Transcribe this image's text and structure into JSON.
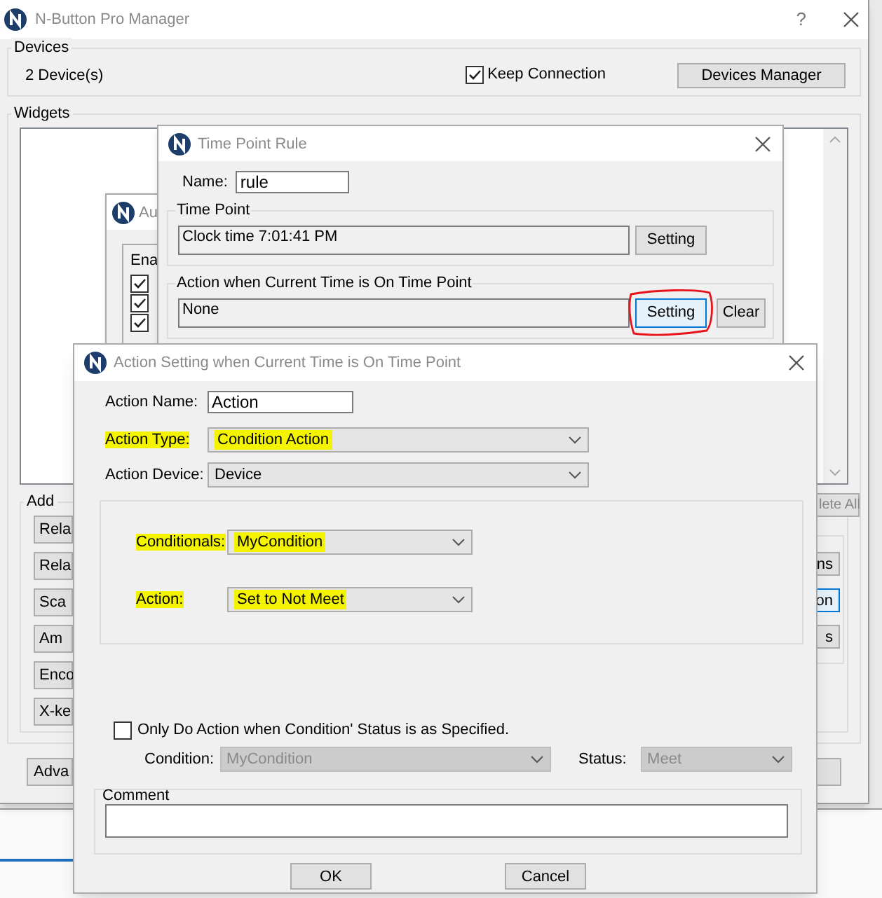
{
  "main_window": {
    "title": "N-Button Pro Manager",
    "help": "?",
    "devices": {
      "label": "Devices",
      "count": "2 Device(s)",
      "keep_connection": {
        "label": "Keep Connection",
        "checked": true
      },
      "manager_button": "Devices Manager"
    },
    "widgets": {
      "label": "Widgets",
      "add": {
        "label": "Add",
        "left_buttons": [
          "Rela",
          "Rela",
          "Sca",
          "Am",
          "Enco",
          "X-ke"
        ],
        "delete_all_button": "lete All",
        "right_buttons": [
          {
            "label": "ns",
            "focused": false
          },
          {
            "label": "on",
            "focused": true
          },
          {
            "label": "s",
            "focused": false
          }
        ]
      }
    },
    "bottom_button": "Adva"
  },
  "auto_window": {
    "title": "Au",
    "column_header": "Ena",
    "rows": [
      {
        "checked": true
      },
      {
        "checked": true
      },
      {
        "checked": true
      }
    ]
  },
  "time_point_window": {
    "title": "Time Point Rule",
    "name_label": "Name:",
    "name_value": "rule",
    "time_point": {
      "label": "Time Point",
      "value": "Clock time 7:01:41 PM",
      "button": {
        "label": "Setting",
        "focused": false
      }
    },
    "action": {
      "label": "Action when Current Time is On Time Point",
      "value": "None",
      "button": {
        "label": "Setting",
        "focused": true,
        "circled": true
      },
      "clear_button": "Clear"
    }
  },
  "action_dialog": {
    "title": "Action Setting when Current Time is On Time Point",
    "action_name": {
      "label": "Action Name:",
      "value": "Action"
    },
    "fields": [
      {
        "label": "Action Type:",
        "value": "Condition Action",
        "highlighted": true
      },
      {
        "label": "Action Device:",
        "value": "Device",
        "highlighted": false
      }
    ],
    "condition_fields": [
      {
        "label": "Conditionals:",
        "value": "MyCondition",
        "highlighted": true
      },
      {
        "label": "Action:",
        "value": "Set to Not Meet",
        "highlighted": true
      }
    ],
    "only_do": {
      "label": "Only Do Action when Condition' Status is as Specified.",
      "checked": false
    },
    "condition": {
      "label": "Condition:",
      "value": "MyCondition",
      "disabled": true
    },
    "status": {
      "label": "Status:",
      "value": "Meet",
      "disabled": true
    },
    "comment": {
      "label": "Comment"
    },
    "buttons": [
      "OK",
      "Cancel"
    ]
  }
}
